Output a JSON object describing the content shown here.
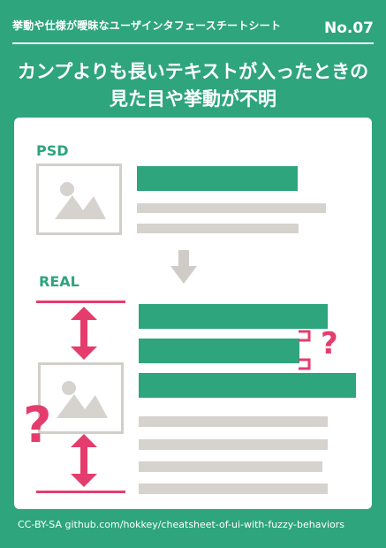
{
  "header": {
    "label": "挙動や仕様が曖昧なユーザインタフェースチートシート",
    "number": "No.07"
  },
  "title": {
    "line1": "カンプよりも長いテキストが入ったときの",
    "line2": "見た目や挙動が不明"
  },
  "diagram": {
    "psd_label": "PSD",
    "real_label": "REAL",
    "question_mark": "?"
  },
  "footer": {
    "credit": "CC-BY-SA github.com/hokkey/cheatsheet-of-ui-with-fuzzy-behaviors"
  },
  "colors": {
    "background": "#2ea57c",
    "accent": "#e53c6e",
    "placeholder": "#d6d3cf"
  }
}
